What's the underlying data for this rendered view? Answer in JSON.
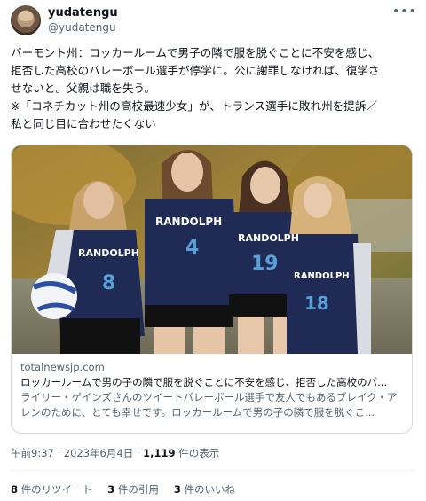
{
  "user": {
    "display_name": "yudatengu",
    "handle": "@yudatengu"
  },
  "more_icon": "more-horizontal-icon",
  "tweet": {
    "text": "バーモント州：ロッカールームで男子の隣で服を脱ぐことに不安を感じ、\n拒否した高校のバレーボール選手が停学に。公に謝罪しなければ、復学さ\nせないと。父親は職を失う。\n※「コネチカット州の高校最速少女」が、トランス選手に敗れ州を提訴／\n私と同じ目に合わせたくない"
  },
  "card": {
    "domain": "totalnewsjp.com",
    "title": "ロッカールームで男の子の隣で服を脱ぐことに不安を感じ、拒否した高校のバ...",
    "description": "ライリー・ゲインズさんのツイートバレーボール選手で友人でもあるブレイク・アレンのために、とても幸せです。ロッカールームで男の子の隣で服を脱ぐこ...",
    "jersey_team": "RANDOLPH",
    "jersey_numbers": [
      "8",
      "4",
      "19",
      "18"
    ]
  },
  "meta": {
    "time": "午前9:37 · 2023年6月4日 · ",
    "views_count": "1,119",
    "views_label": " 件の表示"
  },
  "stats": {
    "retweets_count": "8",
    "retweets_label": " 件のリツイート",
    "quotes_count": "3",
    "quotes_label": " 件の引用",
    "likes_count": "3",
    "likes_label": " 件のいいね"
  }
}
